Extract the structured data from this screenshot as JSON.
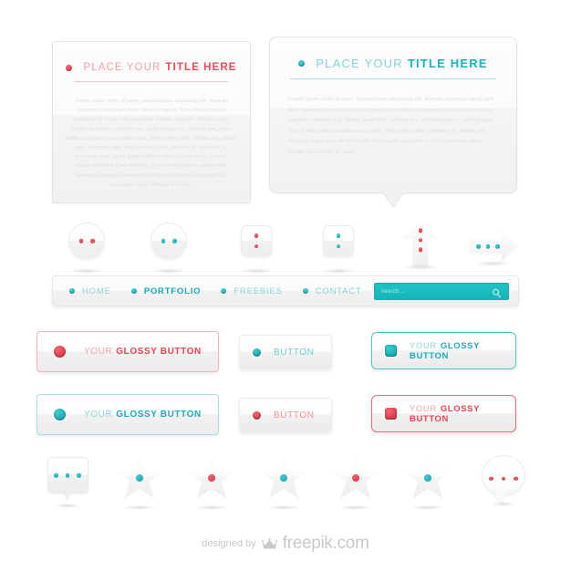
{
  "panels": [
    {
      "title_light": "PLACE YOUR",
      "title_bold": "TITLE HERE",
      "accent": "#ea4a55",
      "bullet": "dot-red-icon",
      "body": "Lorem ipsum dolor sit amet, consectetuer adipiscing elit. Aenean commodo ligula eget dolor. Aenean massa. Cum sociis natoque penatibus et magnis dis parturient montes, nascetur ridiculus mus. Donec quam felis, ultricies nec, pellentesque eu, pretium quis, sem. Nulla consequat massa quis enim. Donec pede justo, fringilla vel, aliquet nec, vulputate eget, arcu. In enim justo, rhoncus ut, imperdiet a, venenatis vitae, justo. Nullam dictum felis eu pede mollis pretium. Integer tincidunt. Cras dapibus. Vivamus elementum semper nisi. Aenean vulputate eleifend tellus. Aenean leo ligula, porttitor eu, consequat vitae, eleifend ac, enim."
    },
    {
      "title_light": "PLACE YOUR",
      "title_bold": "TITLE HERE",
      "accent": "#19b2bd",
      "bullet": "dot-teal-icon",
      "body": "Lorem ipsum dolor sit amet, consectetuer adipiscing elit. Aenean commodo ligula eget dolor. Aenean massa. Cum sociis natoque penatibus et magnis dis parturient montes, nascetur ridiculus mus. Donec quam felis, ultricies nec, pellentesque eu, pretium quis, sem. Nulla consequat massa quis enim. Donec pede justo, fringilla vel, aliquet nec, vulputate eget, arcu. In enim justo, rhoncus ut, imperdiet a, venenatis vitae, justo. Nullam dictum felis eu pede."
    }
  ],
  "shapes_row": [
    {
      "name": "circle-two-red-dots",
      "form": "circle",
      "dots": 2,
      "color": "red",
      "layout": "horizontal"
    },
    {
      "name": "circle-two-teal-dots",
      "form": "circle",
      "dots": 2,
      "color": "teal",
      "layout": "horizontal"
    },
    {
      "name": "square-two-red-dots",
      "form": "square",
      "dots": 2,
      "color": "red",
      "layout": "vertical"
    },
    {
      "name": "square-two-teal-dots",
      "form": "square",
      "dots": 2,
      "color": "teal",
      "layout": "vertical"
    },
    {
      "name": "arrow-up-red-dots",
      "form": "arrow-up",
      "dots": 3,
      "color": "red",
      "layout": "vertical"
    },
    {
      "name": "arrow-right-teal-dots",
      "form": "arrow-right",
      "dots": 3,
      "color": "teal",
      "layout": "horizontal"
    }
  ],
  "navbar": {
    "items": [
      {
        "label": "HOME",
        "active": false
      },
      {
        "label": "PORTFOLIO",
        "active": true
      },
      {
        "label": "FREEBIES",
        "active": false
      },
      {
        "label": "CONTACT",
        "active": false
      }
    ],
    "search": {
      "placeholder": "search...",
      "icon": "magnifier-icon",
      "background": "#1abcbc"
    },
    "accent": "#14a9b4"
  },
  "buttons": [
    {
      "name": "glossy-button-red-outline",
      "word1": "YOUR",
      "word2": "GLOSSY BUTTON",
      "indicator": "circle",
      "indicator_color": "red",
      "text_style": "red",
      "border": "light-red",
      "size": "wide"
    },
    {
      "name": "button-teal-plain",
      "word1": "BUTTON",
      "word2": "",
      "indicator": "circle",
      "indicator_color": "teal",
      "text_style": "teal-plain",
      "border": "plain",
      "size": "small"
    },
    {
      "name": "glossy-button-teal-outline",
      "word1": "YOUR",
      "word2": "GLOSSY BUTTON",
      "indicator": "square",
      "indicator_color": "teal",
      "text_style": "teal",
      "border": "strong-teal",
      "size": "wide"
    },
    {
      "name": "glossy-button-teal-outline-circle",
      "word1": "YOUR",
      "word2": "GLOSSY BUTTON",
      "indicator": "circle",
      "indicator_color": "teal",
      "text_style": "teal",
      "border": "light-teal",
      "size": "wide"
    },
    {
      "name": "button-red-plain",
      "word1": "BUTTON",
      "word2": "",
      "indicator": "circle",
      "indicator_color": "red",
      "text_style": "red-plain",
      "border": "plain",
      "size": "small"
    },
    {
      "name": "glossy-button-red-strong",
      "word1": "YOUR",
      "word2": "GLOSSY BUTTON",
      "indicator": "square",
      "indicator_color": "red",
      "text_style": "red",
      "border": "strong-red",
      "size": "wide"
    }
  ],
  "bottom_row": [
    {
      "name": "speech-bubble-square-icon",
      "form": "bubble-square",
      "dots": 3,
      "color": "teal"
    },
    {
      "name": "star-teal-icon",
      "form": "star",
      "dots": 1,
      "color": "teal"
    },
    {
      "name": "star-red-icon",
      "form": "star",
      "dots": 1,
      "color": "red"
    },
    {
      "name": "star-teal-icon",
      "form": "star",
      "dots": 1,
      "color": "teal"
    },
    {
      "name": "star-red-icon",
      "form": "star",
      "dots": 1,
      "color": "red"
    },
    {
      "name": "star-teal-icon",
      "form": "star",
      "dots": 1,
      "color": "teal"
    },
    {
      "name": "speech-bubble-round-icon",
      "form": "bubble-round",
      "dots": 3,
      "color": "red"
    }
  ],
  "footer": {
    "designed_by": "designed by",
    "brand": "freepik.com",
    "icon": "crown-icon",
    "color": "#c9c9c9"
  },
  "colors": {
    "red": "#ea4a55",
    "red_light": "#f4a7ab",
    "teal": "#16aeb9",
    "teal_light": "#8ed8dc",
    "background": "#ffffff",
    "panel_gray": "#f1f1f1"
  }
}
